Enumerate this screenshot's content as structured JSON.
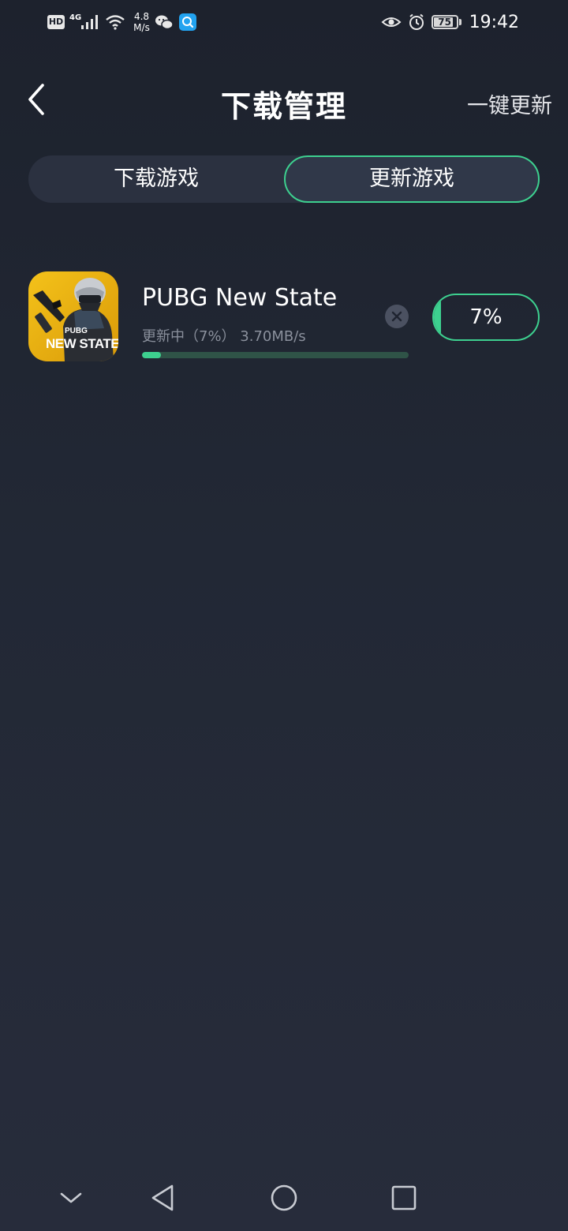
{
  "status_bar": {
    "hd_badge": "HD",
    "network_type": "4G",
    "speed_value": "4.8",
    "speed_unit": "M/s",
    "battery": "75",
    "time": "19:42",
    "icons": [
      "hd-icon",
      "signal-icon",
      "wifi-icon",
      "wechat-icon",
      "search-app-icon",
      "eye-icon",
      "alarm-icon",
      "battery-icon"
    ]
  },
  "header": {
    "title": "下载管理",
    "update_all": "一键更新"
  },
  "tabs": [
    {
      "label": "下载游戏",
      "active": false
    },
    {
      "label": "更新游戏",
      "active": true
    }
  ],
  "games": [
    {
      "name": "PUBG New State",
      "status": "更新中（7%） 3.70MB/s",
      "progress": 0.07,
      "percent_label": "7%",
      "icon_text_top": "PUBG",
      "icon_text_bottom": "NEW STATE"
    }
  ],
  "colors": {
    "accent": "#3dd08f",
    "background": "#222835",
    "tab_track": "#2b3140",
    "muted_text": "#8a909c"
  },
  "nav_icons": [
    "collapse-icon",
    "back-triangle-icon",
    "home-circle-icon",
    "recents-square-icon"
  ]
}
